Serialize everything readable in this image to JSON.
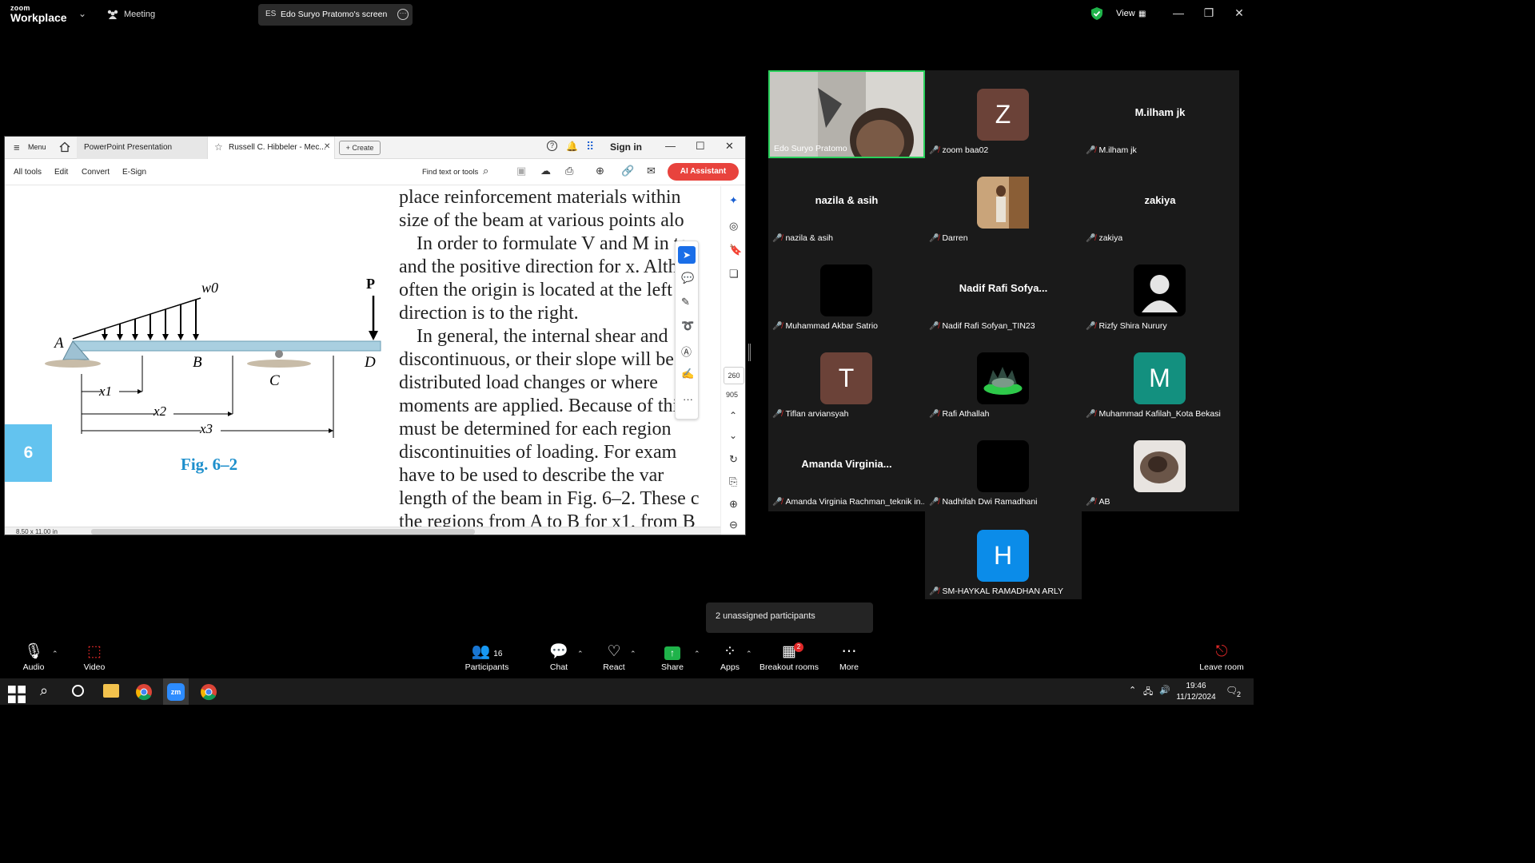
{
  "zoom": {
    "logo_small": "zoom",
    "logo_big": "Workplace",
    "meeting_label": "Meeting",
    "screen_tab_initials": "ES",
    "screen_tab_label": "Edo Suryo Pratomo's screen",
    "view_label": "View"
  },
  "acrobat": {
    "menu_label": "Menu",
    "tab1": "PowerPoint Presentation",
    "tab2": "Russell C. Hibbeler - Mec...",
    "create_label": "+ Create",
    "sign_in": "Sign in",
    "tools": [
      "All tools",
      "Edit",
      "Convert",
      "E-Sign"
    ],
    "find_label": "Find text or tools",
    "ai_label": "AI Assistant",
    "page_num": "260",
    "page_total": "905",
    "page_size": "8.50 x 11.00 in"
  },
  "document": {
    "lines": [
      "place reinforcement materials within",
      "size of the beam at various points alo",
      "In order to formulate V and M in te",
      "and the positive direction for x. Alth",
      "often the origin is located at the left",
      "direction is to the right.",
      "In general, the internal shear and",
      "discontinuous, or their slope will be",
      "distributed load changes or where",
      "moments are applied. Because of this",
      "must be determined for each region",
      "discontinuities of loading. For exam",
      "have to be used to describe the var",
      "length of the beam in Fig. 6–2. These c",
      "the regions from A to B for x1, from B"
    ],
    "chapter": "6",
    "figure_caption": "Fig. 6–2",
    "figure_labels": {
      "w0": "w0",
      "P": "P",
      "A": "A",
      "B": "B",
      "C": "C",
      "D": "D",
      "x1": "x1",
      "x2": "x2",
      "x3": "x3"
    }
  },
  "participants": [
    {
      "name": "Edo Suryo Pratomo",
      "type": "video",
      "muted": false
    },
    {
      "name": "zoom baa02",
      "type": "letter",
      "letter": "Z",
      "color": "#6b4238",
      "muted": true
    },
    {
      "name": "M.ilham jk",
      "type": "text",
      "big": "M.ilham jk",
      "muted": true
    },
    {
      "name": "nazila & asih",
      "type": "text",
      "big": "nazila & asih",
      "muted": true
    },
    {
      "name": "Darren",
      "type": "photo",
      "muted": true
    },
    {
      "name": "zakiya",
      "type": "text",
      "big": "zakiya",
      "muted": true
    },
    {
      "name": "Muhammad Akbar Satrio",
      "type": "black",
      "muted": true
    },
    {
      "name": "Nadif Rafi Sofyan_TIN23",
      "type": "text",
      "big": "Nadif Rafi Sofya...",
      "muted": true
    },
    {
      "name": "Rizfy Shira Nurury",
      "type": "person",
      "muted": true
    },
    {
      "name": "Tiflan arviansyah",
      "type": "letter",
      "letter": "T",
      "color": "#6b4238",
      "muted": true
    },
    {
      "name": "Rafi Athallah",
      "type": "photo-dark",
      "muted": true
    },
    {
      "name": "Muhammad Kafilah_Kota Bekasi",
      "type": "letter",
      "letter": "M",
      "color": "#13907f",
      "muted": true
    },
    {
      "name": "Amanda Virginia Rachman_teknik in...",
      "type": "text",
      "big": "Amanda Virginia...",
      "muted": true
    },
    {
      "name": "Nadhifah Dwi Ramadhani",
      "type": "black",
      "muted": true
    },
    {
      "name": "AB",
      "type": "photo-light",
      "muted": true
    },
    {
      "name": "SM-HAYKAL RAMADHAN ARLY",
      "type": "letter",
      "letter": "H",
      "color": "#0b8ce9",
      "muted": true
    }
  ],
  "unassigned": "2 unassigned participants",
  "controls": {
    "audio": "Audio",
    "video": "Video",
    "participants": "Participants",
    "participants_count": "16",
    "chat": "Chat",
    "react": "React",
    "share": "Share",
    "apps": "Apps",
    "breakout": "Breakout rooms",
    "breakout_badge": "2",
    "more": "More",
    "leave": "Leave room"
  },
  "taskbar": {
    "time": "19:46",
    "date": "11/12/2024",
    "notifications": "2"
  }
}
